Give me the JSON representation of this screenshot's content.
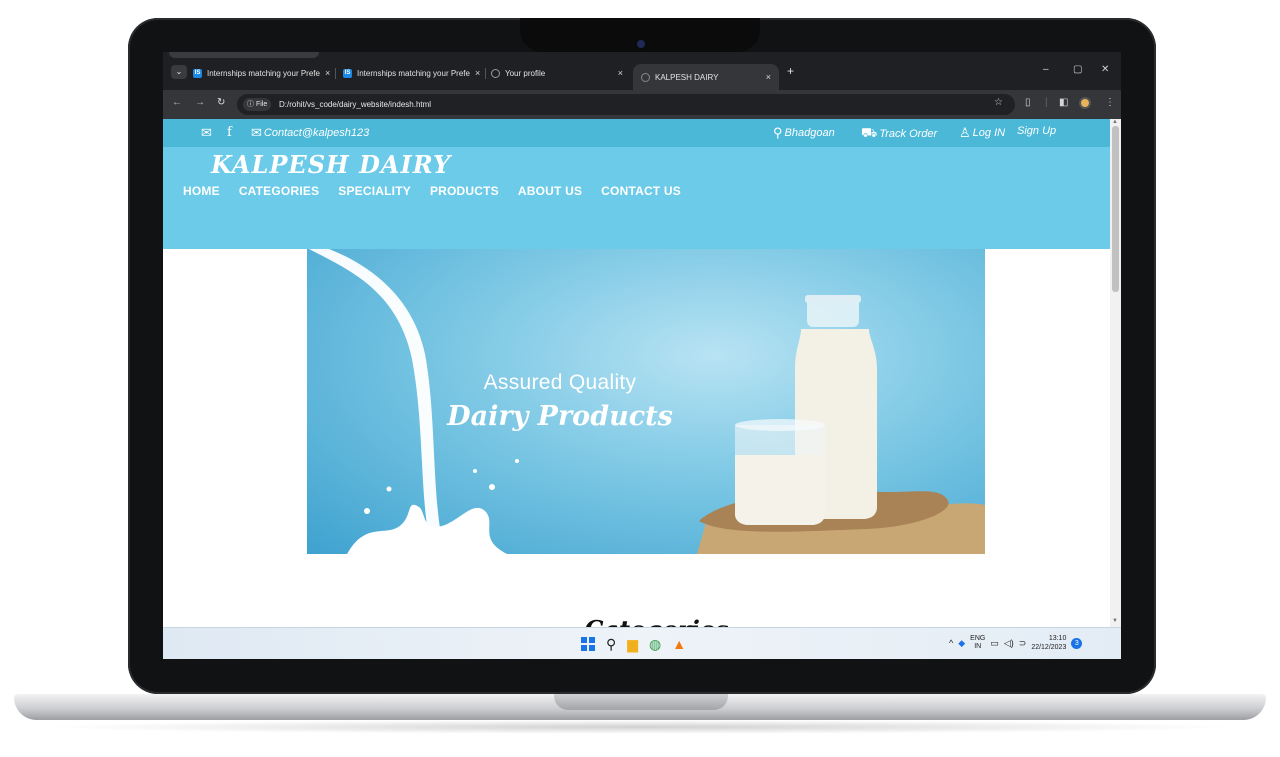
{
  "browser": {
    "tabs": [
      {
        "title": "Internships matching your Prefe",
        "favicon": "internshala-icon"
      },
      {
        "title": "Internships matching your Prefe",
        "favicon": "internshala-icon"
      },
      {
        "title": "Your profile",
        "favicon": "github-icon"
      },
      {
        "title": "KALPESH DAIRY",
        "favicon": "globe-icon",
        "active": true
      }
    ],
    "new_tab": "+",
    "close_glyph": "×",
    "address": {
      "scheme_label": "File",
      "url": "D:/rohit/vs_code/dairy_website/indesh.html"
    },
    "window_controls": {
      "minimize": "–",
      "restore": "▢",
      "close": "✕"
    }
  },
  "site": {
    "topbar": {
      "email": "Contact@kalpesh123",
      "location": "Bhadgoan",
      "track_order": "Track Order",
      "login": "Log IN",
      "signup": "Sign Up"
    },
    "brand": "KALPESH DAIRY",
    "nav": [
      "HOME",
      "CATEGORIES",
      "SPECIALITY",
      "PRODUCTS",
      "ABOUT US",
      "CONTACT US"
    ],
    "hero": {
      "line1": "Assured Quality",
      "line2": "Dairy Products"
    },
    "section_title": "Categories"
  },
  "taskbar": {
    "lang": "ENG",
    "region": "IN",
    "time": "13:10",
    "date": "22/12/2023",
    "notifications": "3"
  },
  "colors": {
    "topbar": "#4cb8d8",
    "header": "#6ccbe8",
    "accent_blue": "#1a73e8"
  }
}
